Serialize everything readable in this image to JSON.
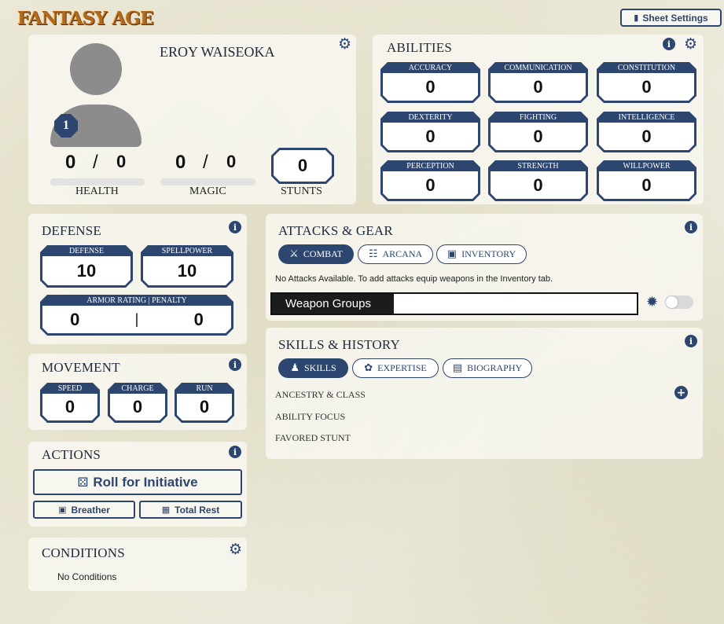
{
  "logo": "FANTASY AGE",
  "sheet_settings_label": "Sheet Settings",
  "character": {
    "name": "EROY WAISEOKA",
    "level": "1",
    "health": {
      "current": "0",
      "max": "0",
      "label": "HEALTH"
    },
    "magic": {
      "current": "0",
      "max": "0",
      "label": "MAGIC"
    },
    "stunts": {
      "value": "0",
      "label": "STUNTS"
    },
    "separator": "/"
  },
  "abilities": {
    "title": "ABILITIES",
    "items": [
      {
        "label": "ACCURACY",
        "value": "0"
      },
      {
        "label": "COMMUNICATION",
        "value": "0"
      },
      {
        "label": "CONSTITUTION",
        "value": "0"
      },
      {
        "label": "DEXTERITY",
        "value": "0"
      },
      {
        "label": "FIGHTING",
        "value": "0"
      },
      {
        "label": "INTELLIGENCE",
        "value": "0"
      },
      {
        "label": "PERCEPTION",
        "value": "0"
      },
      {
        "label": "STRENGTH",
        "value": "0"
      },
      {
        "label": "WILLPOWER",
        "value": "0"
      }
    ]
  },
  "defense": {
    "title": "DEFENSE",
    "defense": {
      "label": "DEFENSE",
      "value": "10"
    },
    "spellpower": {
      "label": "SPELLPOWER",
      "value": "10"
    },
    "armor": {
      "label": "ARMOR RATING | PENALTY",
      "rating": "0",
      "penalty": "0",
      "divider": "|"
    }
  },
  "movement": {
    "title": "MOVEMENT",
    "speed": {
      "label": "SPEED",
      "value": "0"
    },
    "charge": {
      "label": "CHARGE",
      "value": "0"
    },
    "run": {
      "label": "RUN",
      "value": "0"
    }
  },
  "actions": {
    "title": "ACTIONS",
    "initiative": "Roll for Initiative",
    "breather": "Breather",
    "total_rest": "Total Rest"
  },
  "conditions": {
    "title": "CONDITIONS",
    "empty": "No Conditions"
  },
  "attacks": {
    "title": "ATTACKS & GEAR",
    "tabs": [
      "COMBAT",
      "ARCANA",
      "INVENTORY"
    ],
    "empty": "No Attacks Available. To add attacks equip weapons in the Inventory tab.",
    "weapon_groups_label": "Weapon Groups",
    "weapon_groups_value": ""
  },
  "skills": {
    "title": "SKILLS & HISTORY",
    "tabs": [
      "SKILLS",
      "EXPERTISE",
      "BIOGRAPHY"
    ],
    "rows": [
      "ANCESTRY & CLASS",
      "ABILITY FOCUS",
      "FAVORED STUNT"
    ]
  },
  "colors": {
    "accent": "#2c4670",
    "background": "#eceadb"
  }
}
